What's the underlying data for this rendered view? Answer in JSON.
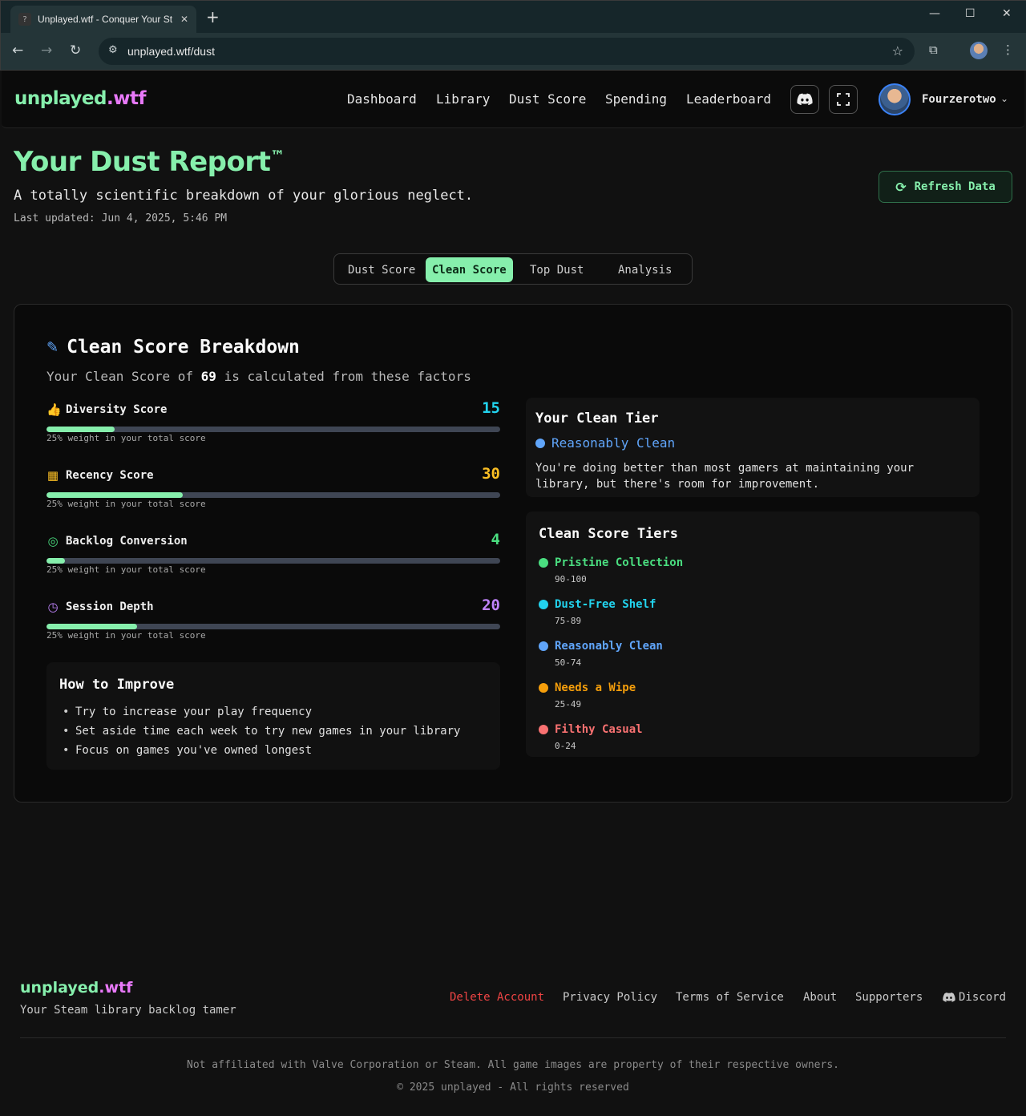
{
  "browser": {
    "tab_title": "Unplayed.wtf - Conquer Your Steam Backlog",
    "tab_favicon": "?",
    "url": "unplayed.wtf/dust"
  },
  "header": {
    "logo_main": "unplayed",
    "logo_suffix": ".wtf",
    "nav": [
      "Dashboard",
      "Library",
      "Dust Score",
      "Spending",
      "Leaderboard"
    ],
    "username": "Fourzerotwo"
  },
  "page": {
    "title": "Your Dust Report",
    "title_mark": "™",
    "subtitle": "A totally scientific breakdown of your glorious neglect.",
    "last_updated": "Last updated: Jun 4, 2025, 5:46 PM",
    "refresh_label": "Refresh Data"
  },
  "tabs": [
    {
      "label": "Dust Score",
      "active": false
    },
    {
      "label": "Clean Score",
      "active": true
    },
    {
      "label": "Top Dust",
      "active": false
    },
    {
      "label": "Analysis",
      "active": false
    }
  ],
  "breakdown": {
    "title": "Clean Score Breakdown",
    "sub_prefix": "Your Clean Score of",
    "score": "69",
    "sub_suffix": "is calculated from these factors",
    "factors": [
      {
        "label": "Diversity Score",
        "value": "15",
        "progress": 15,
        "weight": "25% weight in your total score",
        "color": "#22d3ee",
        "icon": "thumbs-up-icon"
      },
      {
        "label": "Recency Score",
        "value": "30",
        "progress": 30,
        "weight": "25% weight in your total score",
        "color": "#fbbf24",
        "icon": "calendar-icon"
      },
      {
        "label": "Backlog Conversion",
        "value": "4",
        "progress": 4,
        "weight": "25% weight in your total score",
        "color": "#4ade80",
        "icon": "target-icon"
      },
      {
        "label": "Session Depth",
        "value": "20",
        "progress": 20,
        "weight": "25% weight in your total score",
        "color": "#c084fc",
        "icon": "clock-icon"
      }
    ]
  },
  "improve": {
    "title": "How to Improve",
    "tips": [
      "Try to increase your play frequency",
      "Set aside time each week to try new games in your library",
      "Focus on games you've owned longest"
    ]
  },
  "tier": {
    "title": "Your Clean Tier",
    "name": "Reasonably Clean",
    "color": "#60a5fa",
    "description": "You're doing better than most gamers at maintaining your library, but there's room for improvement."
  },
  "tiers": {
    "title": "Clean Score Tiers",
    "items": [
      {
        "name": "Pristine Collection",
        "range": "90-100",
        "color": "#4ade80"
      },
      {
        "name": "Dust-Free Shelf",
        "range": "75-89",
        "color": "#22d3ee"
      },
      {
        "name": "Reasonably Clean",
        "range": "50-74",
        "color": "#60a5fa"
      },
      {
        "name": "Needs a Wipe",
        "range": "25-49",
        "color": "#f59e0b"
      },
      {
        "name": "Filthy Casual",
        "range": "0-24",
        "color": "#f87171"
      }
    ]
  },
  "footer": {
    "logo_main": "unplayed",
    "logo_suffix": ".wtf",
    "tagline": "Your Steam library backlog tamer",
    "links": [
      "Delete Account",
      "Privacy Policy",
      "Terms of Service",
      "About",
      "Supporters",
      "Discord"
    ],
    "disclaimer": "Not affiliated with Valve Corporation or Steam. All game images are property of their respective owners.",
    "copyright": "© 2025 unplayed - All rights reserved"
  }
}
